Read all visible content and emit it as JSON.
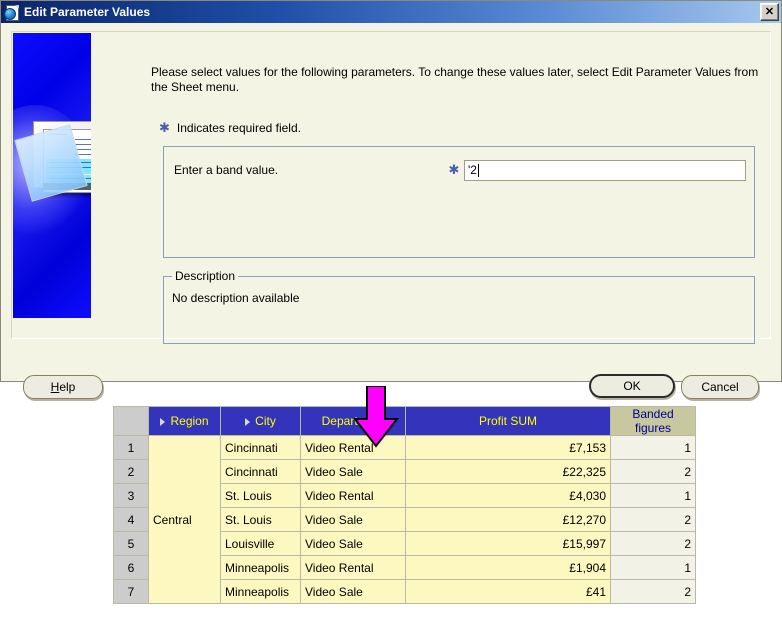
{
  "window": {
    "title": "Edit Parameter Values",
    "icon": "document-globe-icon",
    "close_label": "✕"
  },
  "dialog": {
    "intro": "Please select values for the following parameters. To change these values later, select Edit Parameter Values from the Sheet menu.",
    "required_note": "Indicates required field.",
    "required_marker": "✱",
    "parameter": {
      "label": "Enter a band value.",
      "required_marker": "✱",
      "value": "'2",
      "placeholder": ""
    },
    "description": {
      "legend": "Description",
      "text": "No description available"
    },
    "buttons": {
      "help_prefix": "H",
      "help_suffix": "elp",
      "help": "Help",
      "ok": "OK",
      "cancel": "Cancel"
    }
  },
  "annotation": {
    "arrow": "down-arrow-annotation",
    "arrow_color": "#ff00ff",
    "points_to": "Department"
  },
  "sheet": {
    "columns": [
      {
        "key": "rownum",
        "label": "",
        "type": "rowheader"
      },
      {
        "key": "region",
        "label": "Region",
        "type": "dimension",
        "drill": true
      },
      {
        "key": "city",
        "label": "City",
        "type": "dimension",
        "drill": true
      },
      {
        "key": "department",
        "label": "Department",
        "type": "dimension",
        "drill": false
      },
      {
        "key": "profit",
        "label": "Profit SUM",
        "type": "measure"
      },
      {
        "key": "banded",
        "label": "Banded\nfigures",
        "label_line1": "Banded",
        "label_line2": "figures",
        "type": "calculation"
      }
    ],
    "region_merged_value": "Central",
    "rows": [
      {
        "rownum": "1",
        "city": "Cincinnati",
        "department": "Video Rental",
        "profit": "£7,153",
        "banded": "1"
      },
      {
        "rownum": "2",
        "city": "Cincinnati",
        "department": "Video Sale",
        "profit": "£22,325",
        "banded": "2"
      },
      {
        "rownum": "3",
        "city": "St. Louis",
        "department": "Video Rental",
        "profit": "£4,030",
        "banded": "1"
      },
      {
        "rownum": "4",
        "city": "St. Louis",
        "department": "Video Sale",
        "profit": "£12,270",
        "banded": "2"
      },
      {
        "rownum": "5",
        "city": "Louisville",
        "department": "Video Sale",
        "profit": "£15,997",
        "banded": "2"
      },
      {
        "rownum": "6",
        "city": "Minneapolis",
        "department": "Video Rental",
        "profit": "£1,904",
        "banded": "1"
      },
      {
        "rownum": "7",
        "city": "Minneapolis",
        "department": "Video Sale",
        "profit": "£41",
        "banded": "2"
      }
    ]
  },
  "colors": {
    "header_bg": "#3333bb",
    "header_text": "#ffff00",
    "band_header_bg": "#c8c8a0",
    "band_header_text": "#00008b",
    "cell_bg": "#fdf8c0",
    "band_cell_bg": "#f2f2e6",
    "rowheader_bg": "#cccccc",
    "dialog_bg": "#f4f4e4",
    "titlebar_start": "#0a246a",
    "titlebar_end": "#a6c8ec",
    "arrow": "#ff00ff"
  }
}
